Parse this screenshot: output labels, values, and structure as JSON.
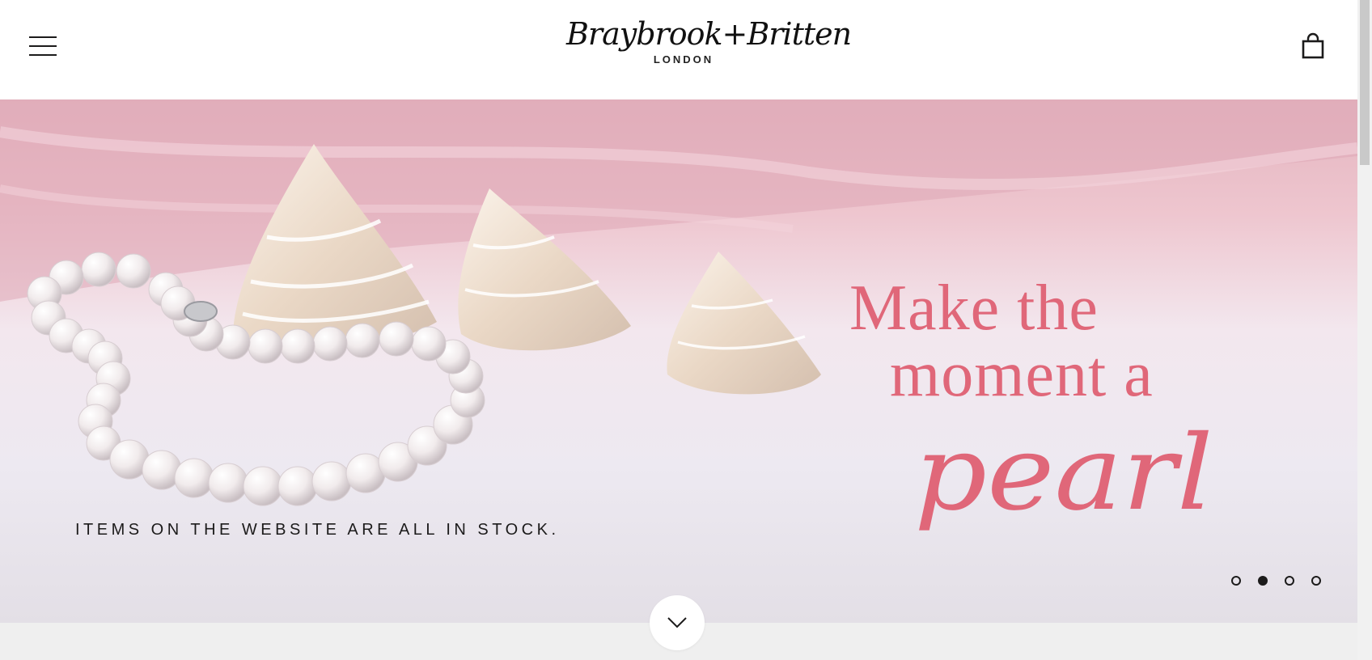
{
  "header": {
    "menu_icon": "hamburger-menu-icon",
    "logo_script": "Braybrook+Britten",
    "logo_city": "LONDON",
    "cart_icon": "shopping-bag-icon"
  },
  "hero": {
    "caption": "ITEMS ON THE WEBSITE ARE ALL IN STOCK.",
    "headline_line1": "Make the",
    "headline_line2": "moment a",
    "headline_line3": "pearl",
    "headline_color": "#e06779",
    "slides_total": 4,
    "active_slide": 2
  },
  "scroll_down_icon": "chevron-down-icon"
}
